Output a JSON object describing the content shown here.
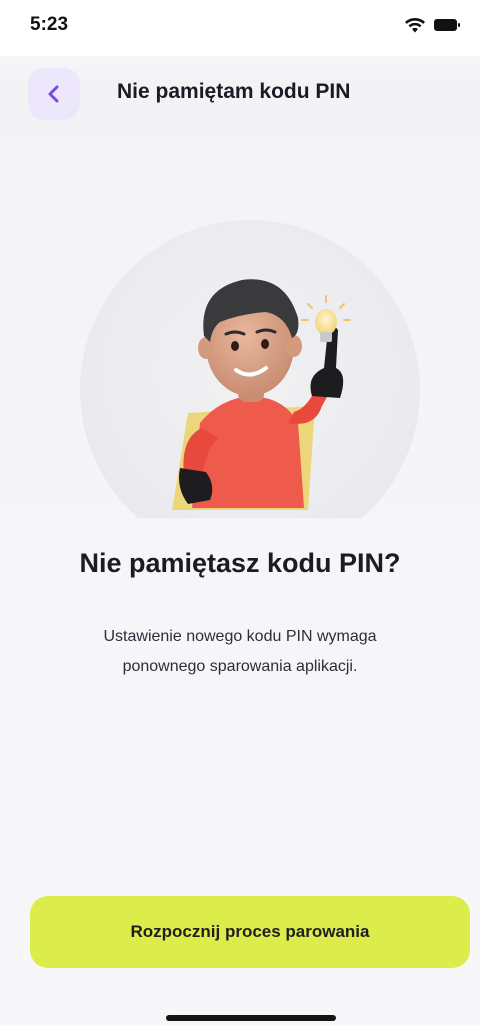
{
  "status_bar": {
    "time": "5:23"
  },
  "nav": {
    "title": "Nie pamiętam kodu PIN",
    "back_icon": "chevron-left-icon"
  },
  "illustration": {
    "description": "character-with-lightbulb"
  },
  "content": {
    "headline": "Nie pamiętasz kodu PIN?",
    "description_line1": "Ustawienie nowego kodu PIN wymaga",
    "description_line2": "ponownego sparowania aplikacji."
  },
  "actions": {
    "start_pairing_label": "Rozpocznij proces parowania"
  },
  "colors": {
    "accent_purple": "#7b4ce0",
    "back_bg": "#ece7fb",
    "primary_button": "#dced4b"
  }
}
